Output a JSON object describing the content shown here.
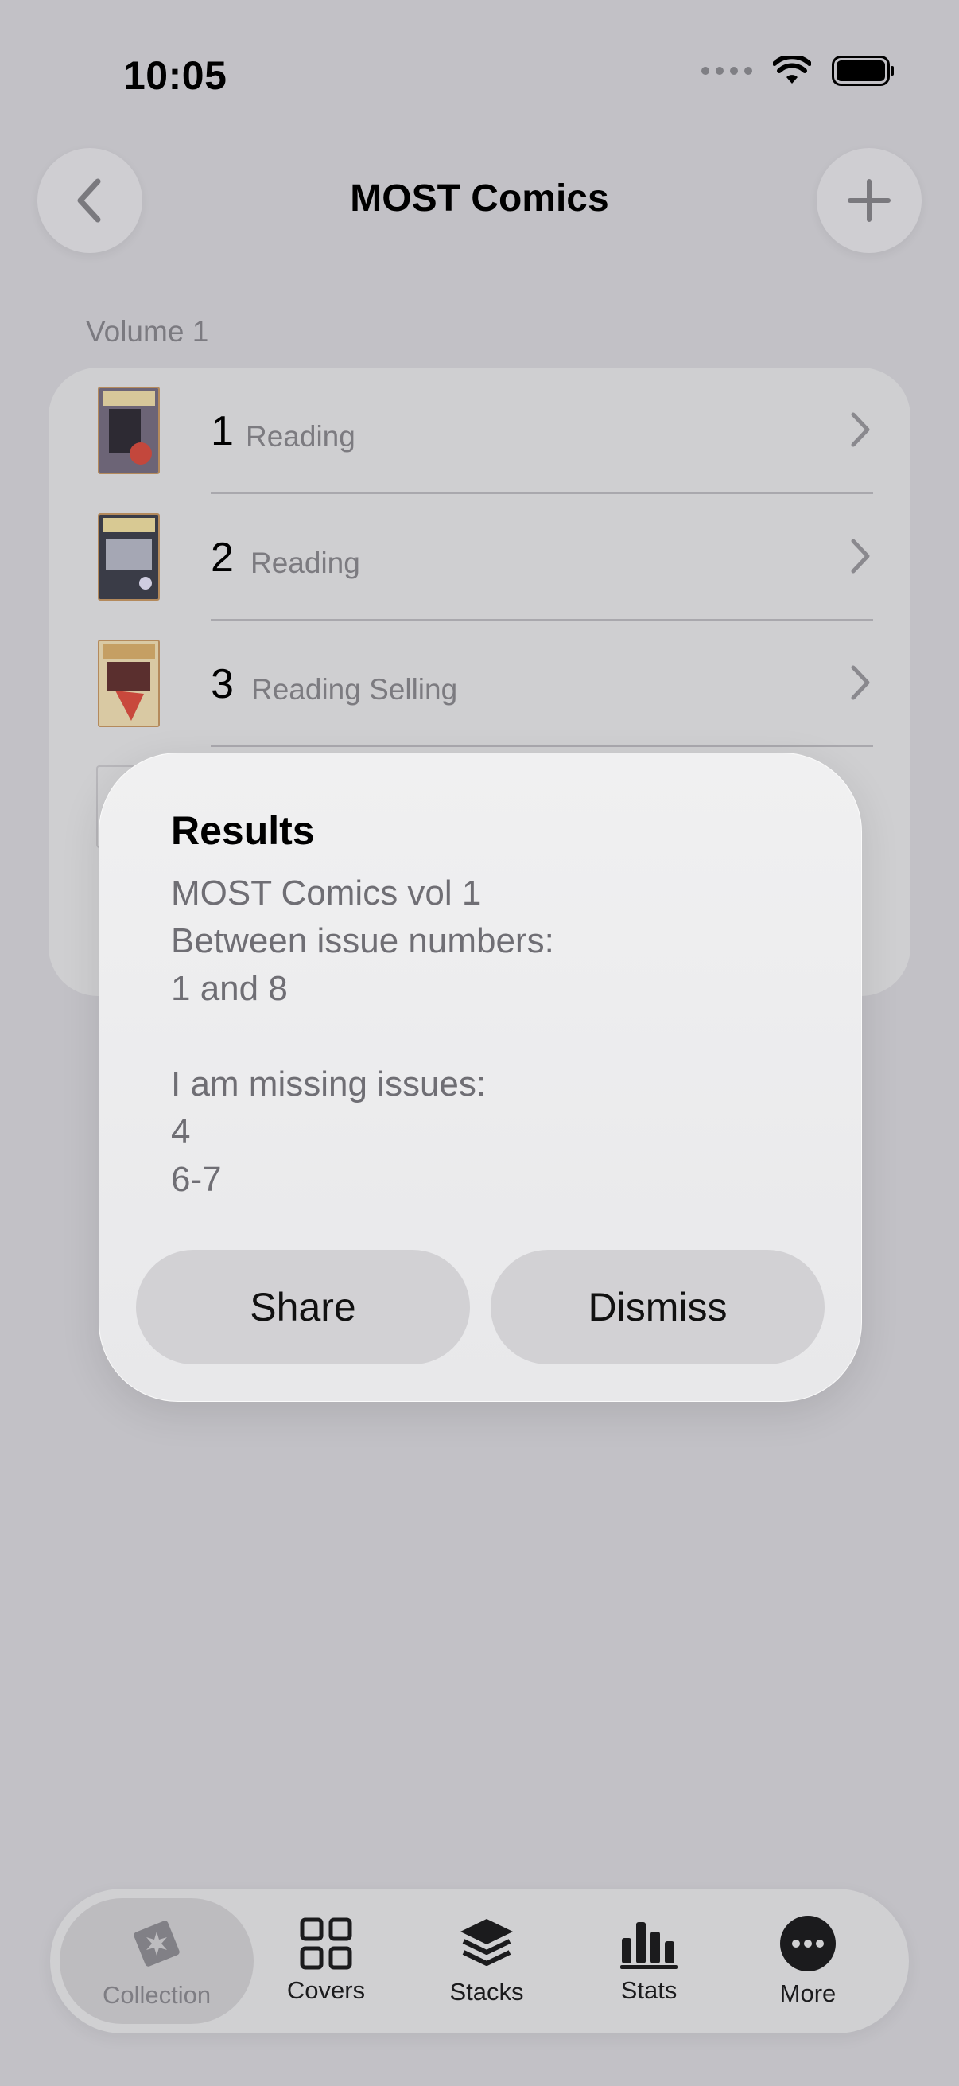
{
  "status_bar": {
    "time": "10:05"
  },
  "nav": {
    "title": "MOST Comics"
  },
  "section": {
    "label": "Volume 1"
  },
  "issues": [
    {
      "number": "1",
      "status": "Reading"
    },
    {
      "number": "2",
      "status": "Reading"
    },
    {
      "number": "3",
      "status": "Reading Selling"
    }
  ],
  "dialog": {
    "title": "Results",
    "lines": [
      "MOST Comics vol 1",
      "Between issue numbers:",
      "1 and 8",
      "",
      "I am missing issues:",
      "4",
      "6-7"
    ],
    "share_label": "Share",
    "dismiss_label": "Dismiss"
  },
  "tabbar": {
    "tabs": [
      {
        "label": "Collection",
        "icon": "collection-icon",
        "selected": true
      },
      {
        "label": "Covers",
        "icon": "grid-icon",
        "selected": false
      },
      {
        "label": "Stacks",
        "icon": "stack-icon",
        "selected": false
      },
      {
        "label": "Stats",
        "icon": "bar-chart-icon",
        "selected": false
      },
      {
        "label": "More",
        "icon": "more-icon",
        "selected": false
      }
    ]
  }
}
